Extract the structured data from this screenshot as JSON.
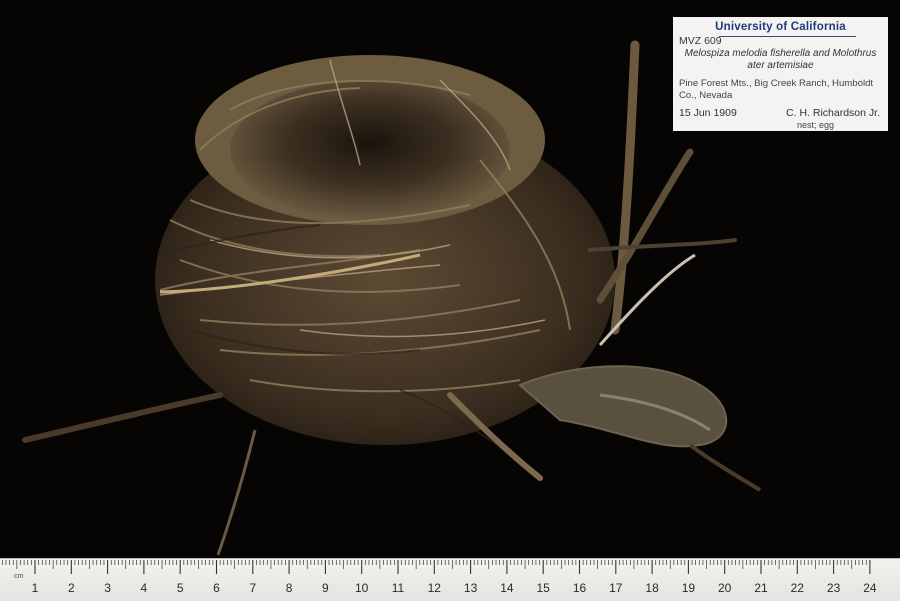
{
  "specimen_label": {
    "institution": "University of California",
    "catalog_number": "MVZ 609",
    "taxon": "Melospiza melodia fisherella and Molothrus ater artemisiae",
    "locality": "Pine Forest Mts., Big Creek Ranch, Humboldt Co., Nevada",
    "date": "15 Jun 1909",
    "collector": "C. H. Richardson Jr.",
    "parts": "nest; egg"
  },
  "ruler": {
    "unit": "cm",
    "marks": [
      "1",
      "2",
      "3",
      "4",
      "5",
      "6",
      "7",
      "8",
      "9",
      "10",
      "11",
      "12",
      "13",
      "14",
      "15",
      "16",
      "17",
      "18",
      "19",
      "20",
      "21",
      "22",
      "23",
      "24"
    ]
  },
  "colors": {
    "background": "#060504",
    "label_card": "#f4f3f1",
    "label_header": "#1f3a7a",
    "nest_dark": "#3a2e20",
    "nest_light": "#9c8a68"
  }
}
